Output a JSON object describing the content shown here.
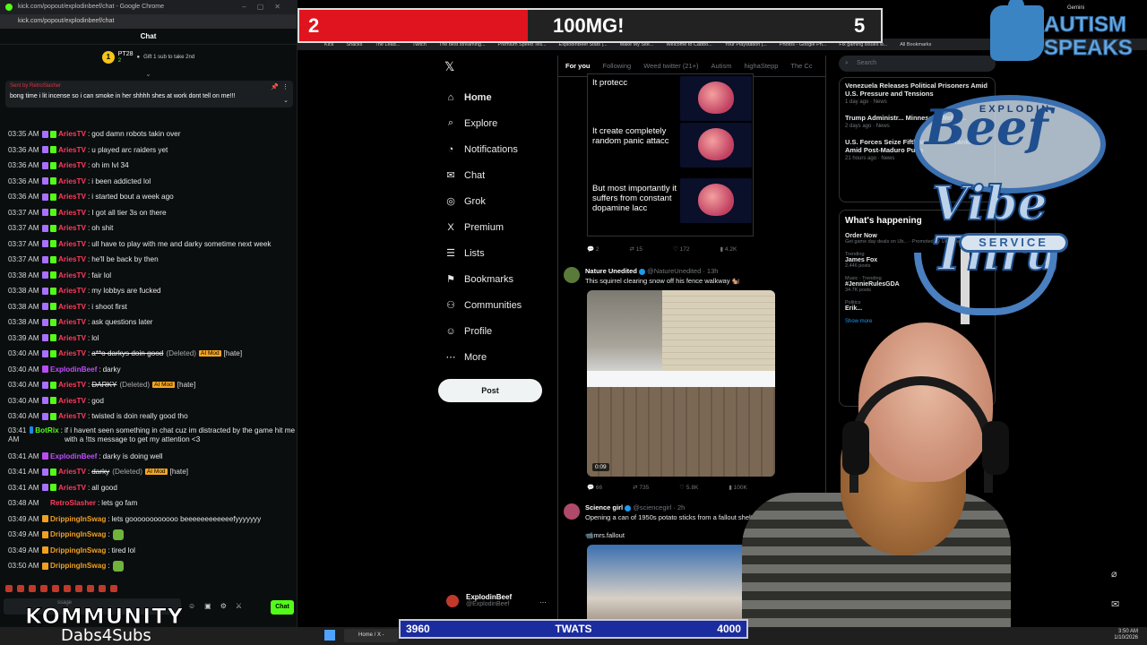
{
  "chat_window": {
    "title": "kick.com/popout/explodinbeef/chat - Google Chrome",
    "url": "kick.com/popout/explodinbeef/chat",
    "header": "Chat",
    "sub_gifter": {
      "rank": "1",
      "name": "PT28",
      "count": "2",
      "text": "Gift 1 sub to take 2nd"
    },
    "pinned": {
      "sent_by": "Sent by",
      "sender": "RetroSlasher",
      "message": "bong time i lit incense so i can smoke in her shhhh shes at work dont tell on me!!!"
    },
    "messages": [
      {
        "ts": "03:35 AM",
        "badge": "sub",
        "user": "AriesTV",
        "color": "#ff3b5c",
        "text": "god damn robots takin over"
      },
      {
        "ts": "03:36 AM",
        "badge": "sub",
        "user": "AriesTV",
        "color": "#ff3b5c",
        "text": "u played arc raiders yet"
      },
      {
        "ts": "03:36 AM",
        "badge": "sub",
        "user": "AriesTV",
        "color": "#ff3b5c",
        "text": "oh im lvl 34"
      },
      {
        "ts": "03:36 AM",
        "badge": "sub",
        "user": "AriesTV",
        "color": "#ff3b5c",
        "text": "i been addicted lol"
      },
      {
        "ts": "03:36 AM",
        "badge": "sub",
        "user": "AriesTV",
        "color": "#ff3b5c",
        "text": "i started bout a week ago"
      },
      {
        "ts": "03:37 AM",
        "badge": "sub",
        "user": "AriesTV",
        "color": "#ff3b5c",
        "text": "I got all tier 3s on there"
      },
      {
        "ts": "03:37 AM",
        "badge": "sub",
        "user": "AriesTV",
        "color": "#ff3b5c",
        "text": "oh shit"
      },
      {
        "ts": "03:37 AM",
        "badge": "sub",
        "user": "AriesTV",
        "color": "#ff3b5c",
        "text": "ull have to play with me and darky sometime next week"
      },
      {
        "ts": "03:37 AM",
        "badge": "sub",
        "user": "AriesTV",
        "color": "#ff3b5c",
        "text": "he'll be back by then"
      },
      {
        "ts": "03:38 AM",
        "badge": "sub",
        "user": "AriesTV",
        "color": "#ff3b5c",
        "text": "fair lol"
      },
      {
        "ts": "03:38 AM",
        "badge": "sub",
        "user": "AriesTV",
        "color": "#ff3b5c",
        "text": "my lobbys are fucked"
      },
      {
        "ts": "03:38 AM",
        "badge": "sub",
        "user": "AriesTV",
        "color": "#ff3b5c",
        "text": "i shoot first"
      },
      {
        "ts": "03:38 AM",
        "badge": "sub",
        "user": "AriesTV",
        "color": "#ff3b5c",
        "text": "ask questions later"
      },
      {
        "ts": "03:39 AM",
        "badge": "sub",
        "user": "AriesTV",
        "color": "#ff3b5c",
        "text": "lol"
      },
      {
        "ts": "03:40 AM",
        "badge": "sub",
        "user": "AriesTV",
        "color": "#ff3b5c",
        "text": "a**o darkys doin good",
        "deleted": "(Deleted)",
        "mod": "AI Mod",
        "tag": "[hate]"
      },
      {
        "ts": "03:40 AM",
        "badge": "mic",
        "user": "ExplodinBeef",
        "color": "#c04dff",
        "text": "darky"
      },
      {
        "ts": "03:40 AM",
        "badge": "sub",
        "user": "AriesTV",
        "color": "#ff3b5c",
        "text": "DARKY",
        "deleted": "(Deleted)",
        "mod": "AI Mod",
        "tag": "[hate]"
      },
      {
        "ts": "03:40 AM",
        "badge": "sub",
        "user": "AriesTV",
        "color": "#ff3b5c",
        "text": "god"
      },
      {
        "ts": "03:40 AM",
        "badge": "sub",
        "user": "AriesTV",
        "color": "#ff3b5c",
        "text": "twisted is doin really good tho"
      },
      {
        "ts": "03:41 AM",
        "badge": "bot",
        "user": "BotRix",
        "color": "#53fc18",
        "text": "if i havent seen something in chat cuz im distracted by the game hit me with a !tts message to get my attention <3",
        "tall": true
      },
      {
        "ts": "03:41 AM",
        "badge": "mic",
        "user": "ExplodinBeef",
        "color": "#c04dff",
        "text": "darky is doing well"
      },
      {
        "ts": "03:41 AM",
        "badge": "sub",
        "user": "AriesTV",
        "color": "#ff3b5c",
        "text": "darky",
        "deleted": "(Deleted)",
        "mod": "AI Mod",
        "tag": "[hate]"
      },
      {
        "ts": "03:41 AM",
        "badge": "sub",
        "user": "AriesTV",
        "color": "#ff3b5c",
        "text": "all good"
      },
      {
        "ts": "03:48 AM",
        "badge": "none",
        "user": "RetroSlasher",
        "color": "#ff3b5c",
        "text": "lets go fam"
      },
      {
        "ts": "03:49 AM",
        "badge": "crown",
        "user": "DrippingInSwag",
        "color": "#f0a020",
        "text": "lets goooooooooooo beeeeeeeeeeeefyyyyyyy"
      },
      {
        "ts": "03:49 AM",
        "badge": "crown",
        "user": "DrippingInSwag",
        "color": "#f0a020",
        "text": "",
        "emote": true
      },
      {
        "ts": "03:49 AM",
        "badge": "crown",
        "user": "DrippingInSwag",
        "color": "#f0a020",
        "text": "tired lol"
      },
      {
        "ts": "03:50 AM",
        "badge": "crown",
        "user": "DrippingInSwag",
        "color": "#f0a020",
        "text": "",
        "emote": true
      }
    ],
    "input_placeholder": "ssage",
    "send_label": "Chat"
  },
  "overlay": {
    "kommunity": "KOMMUNITY",
    "dabs": "Dabs4Subs",
    "score_left": "2",
    "score_title": "100MG!",
    "score_right": "5",
    "autism_1": "AUTISM",
    "autism_2": "SPEAKS",
    "beef_ring": "EXPLODIN",
    "beef_word": "Beef",
    "vibe_word": "Vibe Thru",
    "service_word": "SERVICE",
    "goal_left": "3960",
    "goal_title": "TWATS",
    "goal_right": "4000"
  },
  "browser": {
    "gemini": "Gemini",
    "bookmarks": [
      "Kick",
      "Snacks",
      "The Lead...",
      "Twitch",
      "The best streaming...",
      "Premium Speed Tes...",
      "ExplodinBeef Stats |...",
      "Make My Site...",
      "Welcome to Cabbo...",
      "Your Playstation |...",
      "Photos - Google Ph...",
      "Fix gaming issues w..."
    ],
    "bookmarks_all": "All Bookmarks"
  },
  "x_nav": {
    "items": [
      {
        "icon": "home-icon",
        "glyph": "⌂",
        "label": "Home"
      },
      {
        "icon": "explore-icon",
        "glyph": "⌕",
        "label": "Explore"
      },
      {
        "icon": "bell-icon",
        "glyph": "◔",
        "label": "Notifications"
      },
      {
        "icon": "chat-icon",
        "glyph": "✉",
        "label": "Chat"
      },
      {
        "icon": "grok-icon",
        "glyph": "◎",
        "label": "Grok"
      },
      {
        "icon": "premium-icon",
        "glyph": "X",
        "label": "Premium"
      },
      {
        "icon": "lists-icon",
        "glyph": "☰",
        "label": "Lists"
      },
      {
        "icon": "bookmark-icon",
        "glyph": "⚑",
        "label": "Bookmarks"
      },
      {
        "icon": "communities-icon",
        "glyph": "⚇",
        "label": "Communities"
      },
      {
        "icon": "profile-icon",
        "glyph": "☺",
        "label": "Profile"
      },
      {
        "icon": "more-icon",
        "glyph": "⋯",
        "label": "More"
      }
    ],
    "post_label": "Post",
    "account_name": "ExplodinBeef",
    "account_handle": "@ExplodinBeef"
  },
  "timeline": {
    "tabs": [
      "For you",
      "Following",
      "Weed twitter (21+)",
      "Autism",
      "highaStepp",
      "The Cc"
    ],
    "meme_lines": [
      "It protecc",
      "It create completely random panic attacc",
      "But most importantly it suffers from constant dopamine lacc"
    ],
    "post1_actions": [
      "2",
      "15",
      "172",
      "4.2K"
    ],
    "post2": {
      "name": "Nature Unedited",
      "handle": "@NatureUnedited · 13h",
      "text": "This squirrel clearing snow off his fence walkway 🐿️",
      "duration": "0:09",
      "actions": [
        "66",
        "735",
        "5.8K",
        "100K"
      ]
    },
    "post3": {
      "name": "Science girl",
      "handle": "@sciencegirl · 2h",
      "text": "Opening a can of 1950s potato sticks from a fallout shelter.",
      "credit": "📹mrs.fallout"
    }
  },
  "right_col": {
    "search": "Search",
    "news": [
      {
        "headline": "Venezuela Releases Political Prisoners Amid U.S. Pressure and Tensions",
        "meta": "1 day ago · News"
      },
      {
        "headline": "Trump Administr... Minnesota Welfar...",
        "meta": "2 days ago · News"
      },
      {
        "headline": "U.S. Forces Seize Fifth Venezue... Tanker Amid Post-Maduro Push",
        "meta": "21 hours ago · News"
      }
    ],
    "whats_title": "What's happening",
    "trends": [
      {
        "cat": "",
        "name": "Order Now",
        "posts": "Get game day deals on Ub... · Promoted by Uber Eats"
      },
      {
        "cat": "Trending",
        "name": "James Fox",
        "posts": "2,446 posts"
      },
      {
        "cat": "Music · Trending",
        "name": "#JennieRulesGDA",
        "posts": "34.7K posts"
      },
      {
        "cat": "Politics",
        "name": "Erik...",
        "posts": ""
      }
    ],
    "show_more": "Show more"
  },
  "taskbar": {
    "item": "Home / X - Goo...",
    "time": "3:50 AM",
    "date": "1/10/2026"
  }
}
